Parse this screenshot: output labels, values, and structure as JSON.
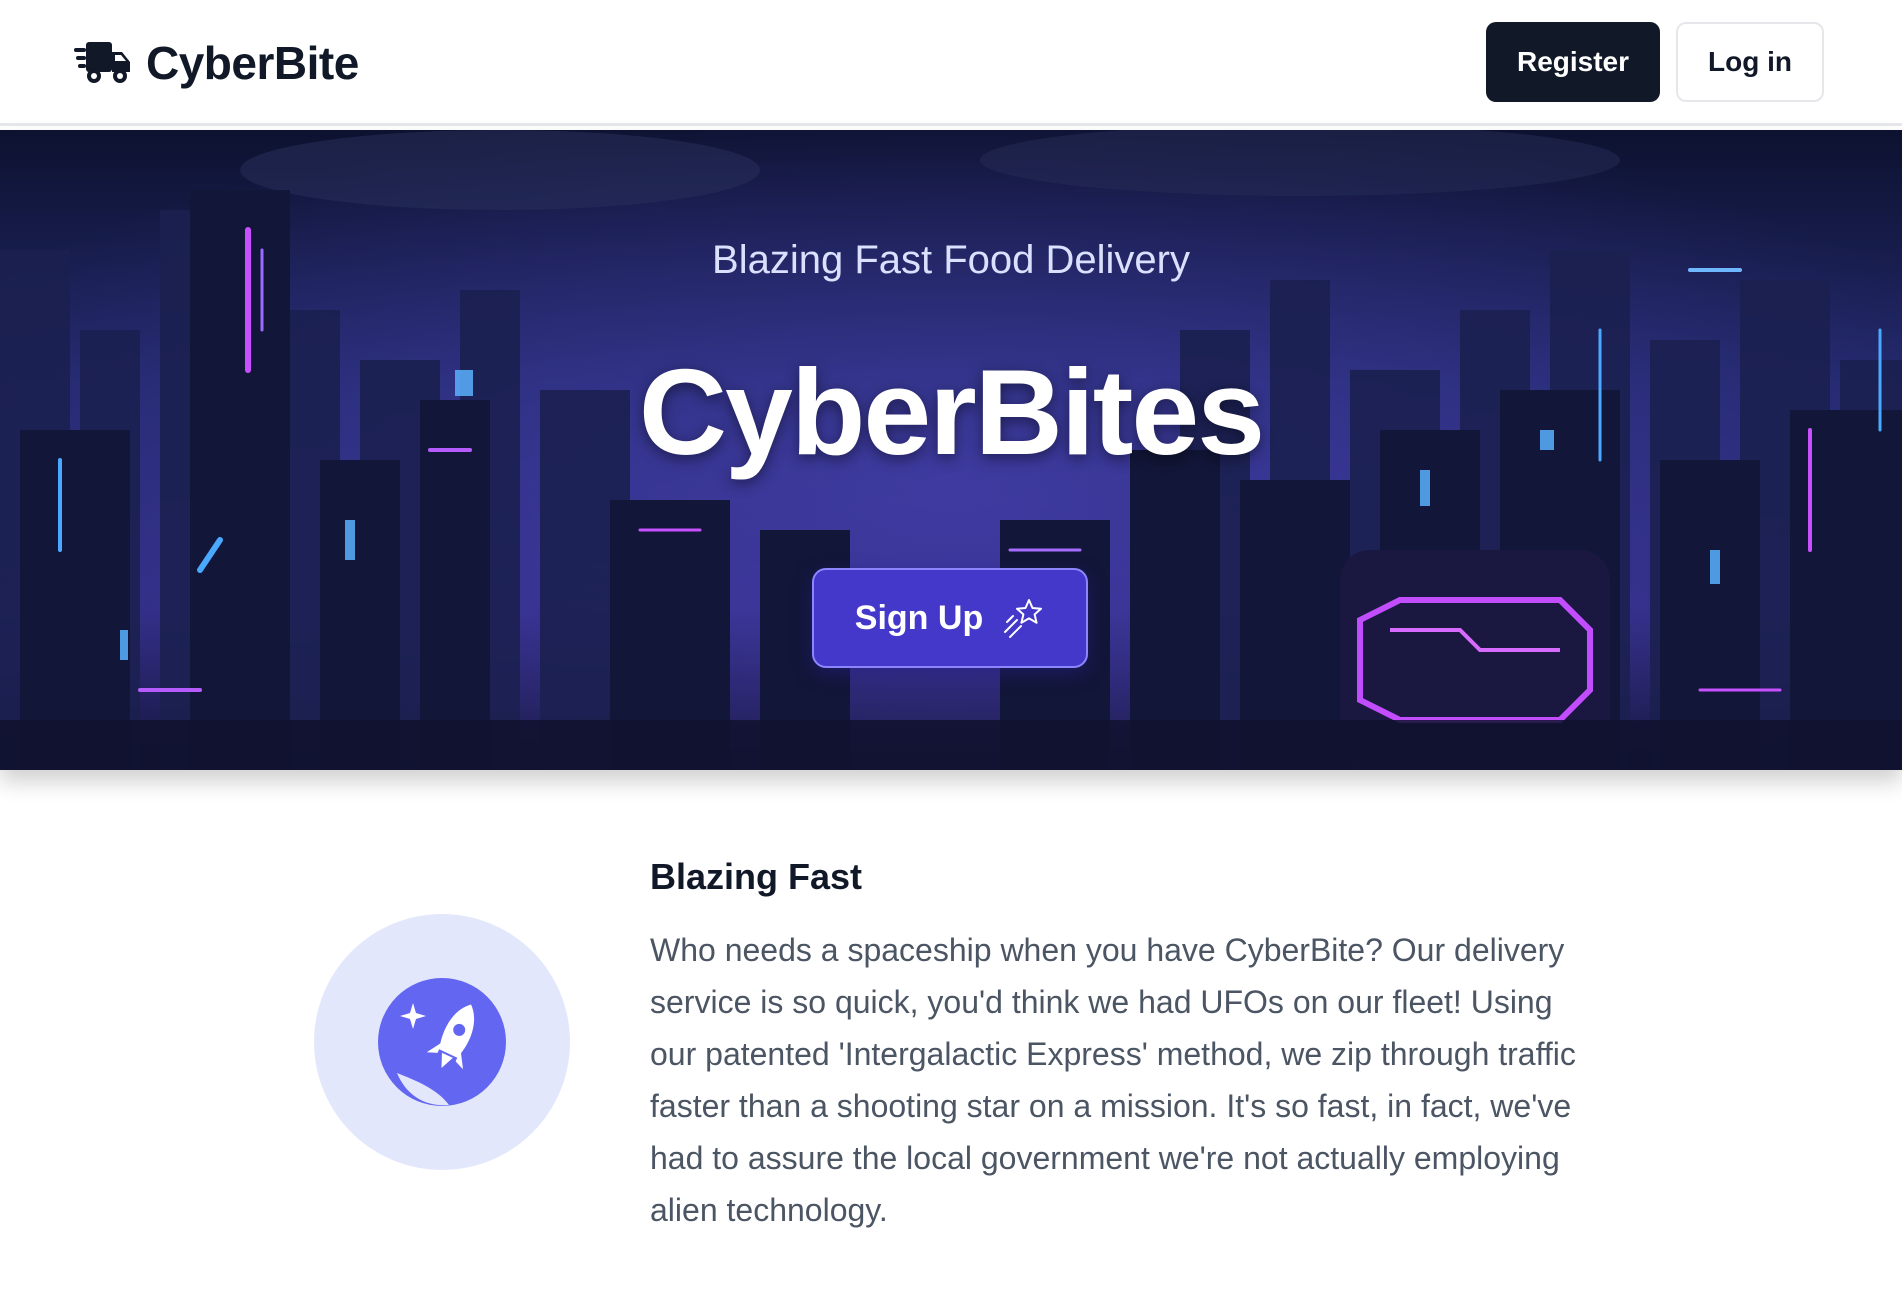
{
  "header": {
    "brand_name": "CyberBite",
    "brand_icon": "delivery-truck-icon",
    "register_label": "Register",
    "login_label": "Log in"
  },
  "hero": {
    "subtitle": "Blazing Fast Food Delivery",
    "title": "CyberBites",
    "signup_label": "Sign Up",
    "signup_icon": "shooting-star-icon"
  },
  "feature": {
    "icon": "rocket-icon",
    "title": "Blazing Fast",
    "text": "Who needs a spaceship when you have CyberBite? Our delivery service is so quick, you'd think we had UFOs on our fleet! Using our patented 'Intergalactic Express' method, we zip through traffic faster than a shooting star on a mission. It's so fast, in fact, we've had to assure the local government we're not actually employing alien technology."
  },
  "colors": {
    "primary_dark": "#111827",
    "signup_purple": "#4338ca",
    "feature_circle_bg": "#e3e7fb",
    "rocket_purple": "#6366f1",
    "body_text": "#4b5563"
  }
}
